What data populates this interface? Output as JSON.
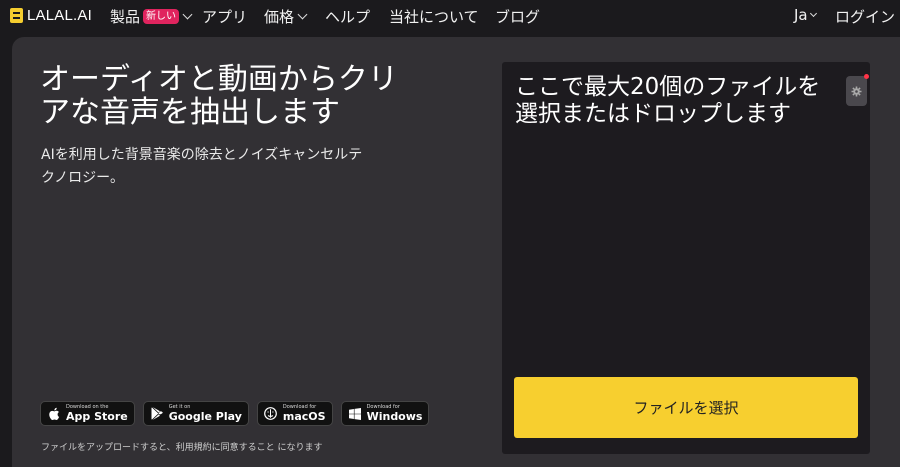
{
  "nav": {
    "logo_text": "LALAL.AI",
    "products_label": "製品",
    "new_badge": "新しい",
    "apps_label": "アプリ",
    "pricing_label": "価格",
    "help_label": "ヘルプ",
    "about_label": "当社について",
    "blog_label": "ブログ",
    "language_label": "Ja",
    "login_label": "ログイン"
  },
  "hero": {
    "headline": "オーディオと動画からクリアな音声を抽出します",
    "subtext": "AIを利用した背景音楽の除去とノイズキャンセルテクノロジー。"
  },
  "stores": [
    {
      "small": "Download on the",
      "big": "App Store",
      "icon": "apple-icon"
    },
    {
      "small": "Get it on",
      "big": "Google Play",
      "icon": "google-play-icon"
    },
    {
      "small": "Download for",
      "big": "macOS",
      "icon": "macos-icon"
    },
    {
      "small": "Download for",
      "big": "Windows",
      "icon": "windows-icon"
    }
  ],
  "disclaimer": "ファイルをアップロードすると、利用規約に同意すること になります",
  "upload": {
    "title": "ここで最大20個のファイルを選択またはドロップします",
    "select_button": "ファイルを選択",
    "settings_icon": "gear-icon"
  },
  "colors": {
    "accent": "#f7cf2f",
    "background": "#1b1a1d",
    "card": "#323034",
    "badge": "#e0245e"
  }
}
